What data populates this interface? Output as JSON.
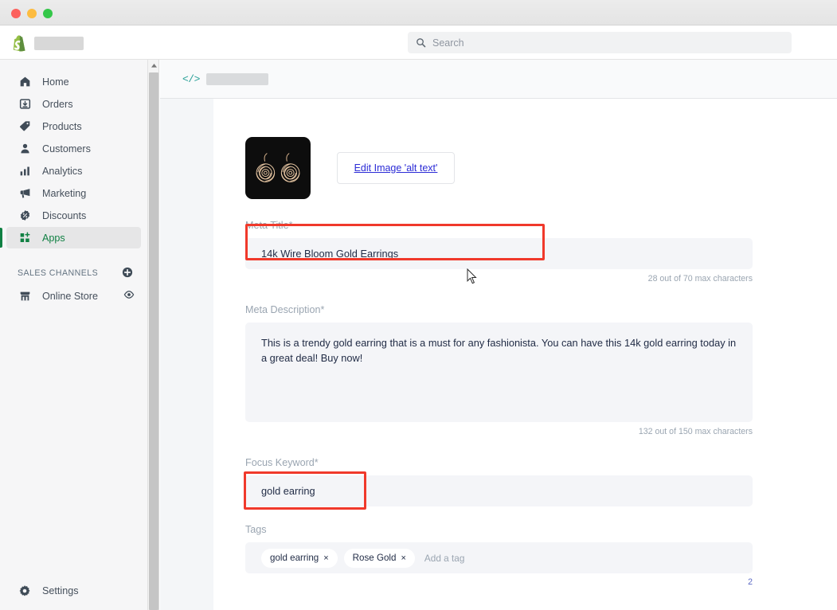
{
  "window": {
    "traffic_lights": [
      "close",
      "minimize",
      "maximize"
    ]
  },
  "appbar": {
    "logo": "shopify-logo",
    "store_name_redacted": true,
    "search": {
      "icon": "search-icon",
      "placeholder": "Search",
      "value": ""
    }
  },
  "sidebar": {
    "items": [
      {
        "label": "Home",
        "icon": "home-icon",
        "active": false
      },
      {
        "label": "Orders",
        "icon": "orders-icon",
        "active": false
      },
      {
        "label": "Products",
        "icon": "tag-icon",
        "active": false
      },
      {
        "label": "Customers",
        "icon": "person-icon",
        "active": false
      },
      {
        "label": "Analytics",
        "icon": "bar-chart-icon",
        "active": false
      },
      {
        "label": "Marketing",
        "icon": "megaphone-icon",
        "active": false
      },
      {
        "label": "Discounts",
        "icon": "discount-icon",
        "active": false
      },
      {
        "label": "Apps",
        "icon": "apps-icon",
        "active": true
      }
    ],
    "sales_channels": {
      "header": "SALES CHANNELS",
      "add_icon": "plus-circle-icon",
      "items": [
        {
          "label": "Online Store",
          "icon": "store-icon",
          "trailing_icon": "eye-icon"
        }
      ]
    },
    "settings": {
      "label": "Settings",
      "icon": "gear-icon"
    }
  },
  "breadcrumb": {
    "icon": "code-icon",
    "title_redacted": true
  },
  "main": {
    "image": {
      "alt_description": "gold rose wire earrings on black background",
      "edit_alt_button_label": "Edit Image 'alt text'"
    },
    "fields": {
      "meta_title": {
        "label": "Meta Title*",
        "value": "14k Wire Bloom Gold Earrings",
        "counter": "28 out of 70 max characters"
      },
      "meta_description": {
        "label": "Meta Description*",
        "value": "This is a trendy gold earring that is a must for any fashionista. You can have this 14k gold earring today in a great deal! Buy now!",
        "counter": "132 out of 150 max characters"
      },
      "focus_keyword": {
        "label": "Focus Keyword*",
        "value": "gold earring"
      },
      "tags": {
        "label": "Tags",
        "pills": [
          {
            "label": "gold earring",
            "remove": "×"
          },
          {
            "label": "Rose Gold",
            "remove": "×"
          }
        ],
        "placeholder": "Add a tag",
        "count": "2"
      }
    }
  },
  "annotations": {
    "color": "#f0392b",
    "boxes": [
      "meta-title-field",
      "focus-keyword-field"
    ]
  },
  "colors": {
    "accent_green": "#108043",
    "link_blue": "#2b2bd6",
    "field_bg": "#f4f5f8",
    "text_dark": "#1f2a44",
    "label_gray": "#9aa5b1"
  }
}
